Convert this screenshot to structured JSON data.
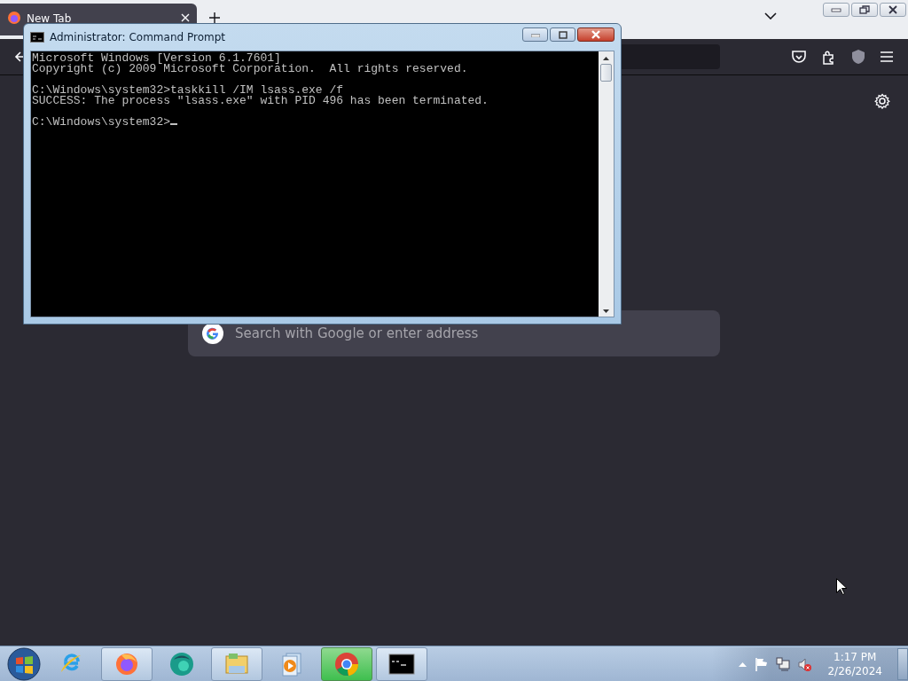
{
  "browser": {
    "tabs": [
      {
        "label": "New Tab",
        "selected": true
      }
    ],
    "search": {
      "placeholder": "Search with Google or enter address"
    }
  },
  "console_window": {
    "title": "Administrator:  Command Prompt",
    "blocks": [
      [
        "Microsoft Windows [Version 6.1.7601]",
        "Copyright (c) 2009 Microsoft Corporation.  All rights reserved."
      ],
      [
        "C:\\Windows\\system32>taskkill /IM lsass.exe /f",
        "SUCCESS: The process \"lsass.exe\" with PID 496 has been terminated."
      ],
      [
        "C:\\Windows\\system32>"
      ]
    ],
    "cursor": true
  },
  "taskbar": {
    "items": [
      {
        "kind": "ie",
        "running": false,
        "highlighted": false
      },
      {
        "kind": "firefox",
        "running": true,
        "highlighted": false
      },
      {
        "kind": "app",
        "running": false,
        "highlighted": false
      },
      {
        "kind": "explorer",
        "running": true,
        "highlighted": false
      },
      {
        "kind": "media",
        "running": false,
        "highlighted": false
      },
      {
        "kind": "chrome",
        "running": true,
        "highlighted": true
      },
      {
        "kind": "console",
        "running": true,
        "highlighted": false
      }
    ],
    "clock": {
      "time": "1:17 PM",
      "date": "2/26/2024"
    }
  }
}
